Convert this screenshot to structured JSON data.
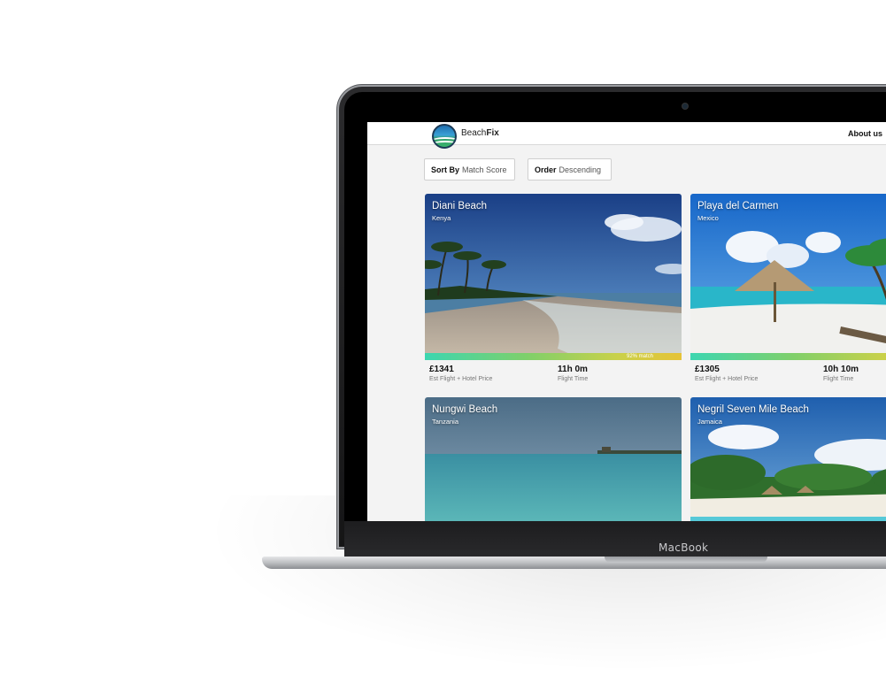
{
  "device": {
    "label": "MacBook"
  },
  "header": {
    "brand_prefix": "Beach",
    "brand_bold": "Fix",
    "about_link": "About us"
  },
  "sort": {
    "sort_by_label": "Sort By",
    "sort_by_value": "Match Score",
    "order_label": "Order",
    "order_value": "Descending"
  },
  "beaches": [
    {
      "name": "Diani Beach",
      "country": "Kenya",
      "match": "92% match",
      "match_pct": 92,
      "price": "£1341",
      "price_label": "Est Flight + Hotel Price",
      "time": "11h 0m",
      "time_label": "Flight Time"
    },
    {
      "name": "Playa del Carmen",
      "country": "Mexico",
      "price": "£1305",
      "price_label": "Est Flight + Hotel Price",
      "time": "10h 10m",
      "time_label": "Flight Time"
    },
    {
      "name": "Nungwi Beach",
      "country": "Tanzania"
    },
    {
      "name": "Negril Seven Mile Beach",
      "country": "Jamaica"
    }
  ],
  "colors": {
    "match_start": "#3cd6b0",
    "match_end": "#e6c337",
    "page_bg": "#f3f3f3"
  }
}
